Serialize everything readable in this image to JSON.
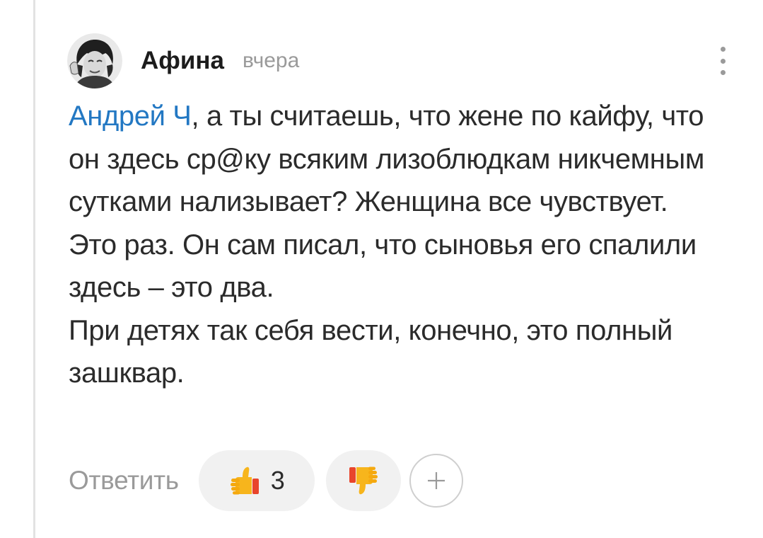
{
  "comment": {
    "author": "Афина",
    "time": "вчера",
    "mention": "Андрей Ч",
    "text_after_mention": ", а ты считаешь, что жене по кайфу, что он здесь ср@ку всяким лизоблюдкам никчемным сутками нализывает? Женщина все чувствует. Это раз. Он сам писал, что сыновья его спалили здесь – это два.",
    "paragraph_2": "При детях так себя вести, конечно, это полный зашквар."
  },
  "actions": {
    "reply_label": "Ответить",
    "like_count": "3",
    "like_icon": "thumbs-up-icon",
    "dislike_icon": "thumbs-down-icon",
    "add_icon": "plus-icon"
  },
  "colors": {
    "mention": "#2378c3",
    "muted": "#9a9a9a",
    "pill_bg": "#f1f1f1",
    "thumb": "#f7b51c",
    "cuff": "#e8452c"
  }
}
